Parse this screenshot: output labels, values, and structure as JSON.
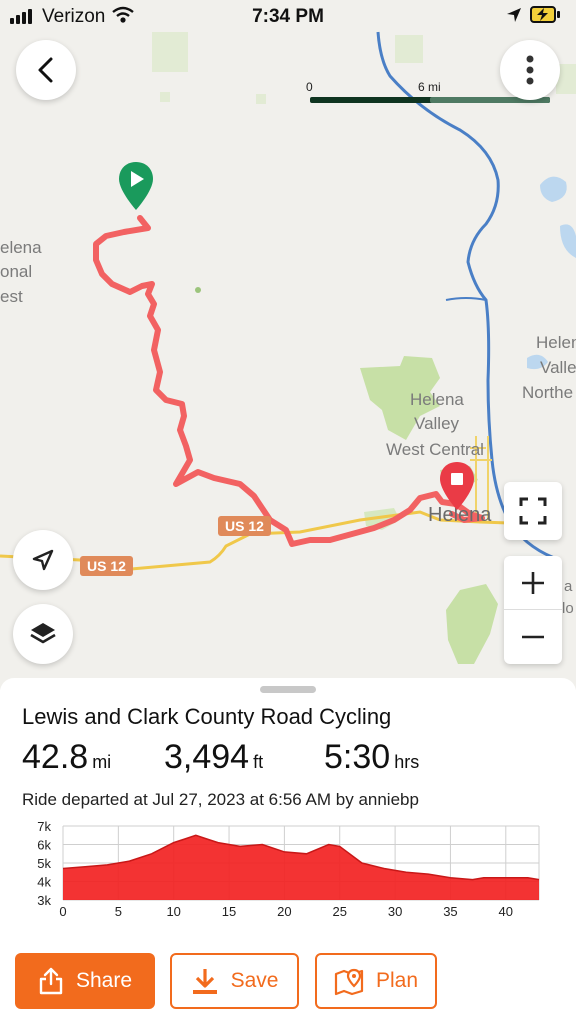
{
  "status_bar": {
    "carrier": "Verizon",
    "time": "7:34 PM"
  },
  "map": {
    "scale": {
      "tick_start": "0",
      "tick_mid": "6 mi",
      "tick_end": "mi"
    },
    "labels": {
      "forest_1": "elena",
      "forest_2": "onal",
      "forest_3": "est",
      "helena_valley_1": "Helena",
      "helena_valley_2": "Valley",
      "west_central": "West Central",
      "helena": "Helena",
      "helen_right": "Helen",
      "valle_right": "Valle",
      "northe_right": "Northe",
      "edge_a": "a",
      "edge_b": "lo"
    },
    "route_shields": [
      "US 12",
      "US 12"
    ],
    "colors": {
      "route": "#f26262",
      "start": "#1a9a5c",
      "end": "#ea3b46",
      "river": "#4a7fc6",
      "highway": "#f0c84a"
    },
    "icons": [
      "back-arrow-icon",
      "more-vertical-icon",
      "locate-icon",
      "layers-icon",
      "fullscreen-icon",
      "zoom-in-icon",
      "zoom-out-icon"
    ]
  },
  "ride": {
    "title": "Lewis and Clark County Road Cycling",
    "distance_value": "42.8",
    "distance_unit": "mi",
    "elevation_value": "3,494",
    "elevation_unit": "ft",
    "duration_value": "5:30",
    "duration_unit": "hrs",
    "meta": "Ride departed at Jul 27, 2023 at 6:56 AM by anniebp"
  },
  "chart_data": {
    "type": "area",
    "x": [
      0,
      2,
      4,
      6,
      8,
      10,
      11,
      12,
      13,
      14,
      16,
      18,
      20,
      22,
      24,
      25,
      27,
      29,
      31,
      33,
      35,
      37,
      38,
      40,
      42,
      43
    ],
    "series": [
      {
        "values": [
          4700,
          4800,
          4900,
          5100,
          5500,
          6100,
          6300,
          6500,
          6300,
          6100,
          5900,
          6000,
          5600,
          5500,
          6000,
          5900,
          5000,
          4700,
          4500,
          4400,
          4200,
          4100,
          4200,
          4200,
          4200,
          4100
        ]
      }
    ],
    "xticks": [
      "0",
      "5",
      "10",
      "15",
      "20",
      "25",
      "30",
      "35",
      "40"
    ],
    "yticks": [
      "7k",
      "6k",
      "5k",
      "4k",
      "3k"
    ],
    "xlim": [
      0,
      43
    ],
    "ylim": [
      3000,
      7000
    ],
    "grid": true,
    "color": "#f22222"
  },
  "actions": {
    "share_label": "Share",
    "save_label": "Save",
    "plan_label": "Plan"
  }
}
